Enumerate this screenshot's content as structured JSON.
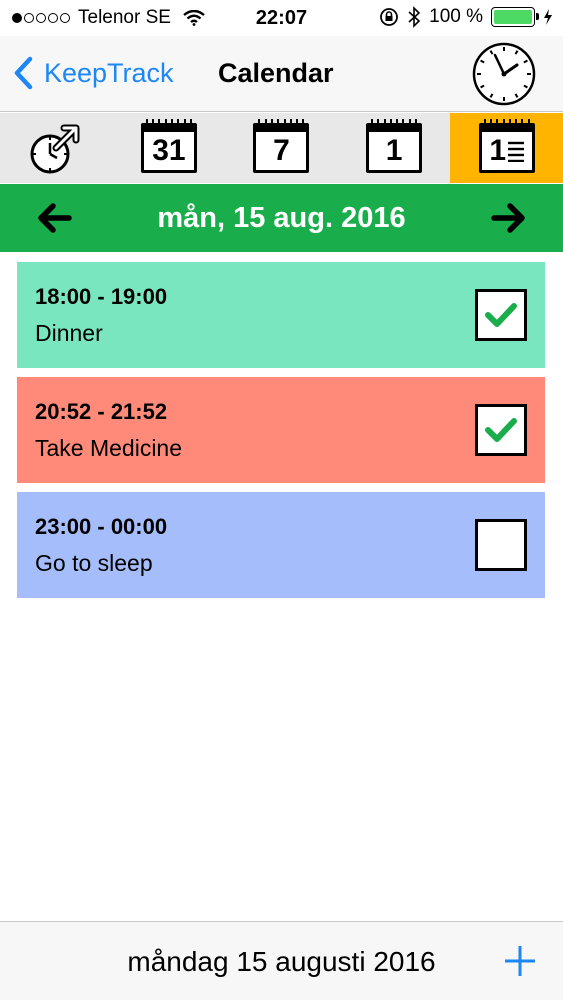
{
  "status_bar": {
    "carrier": "Telenor SE",
    "time": "22:07",
    "battery": "100 %",
    "battery_color": "#4cd964"
  },
  "nav": {
    "back_label": "KeepTrack",
    "title": "Calendar",
    "accent": "#1c87f5"
  },
  "view_toolbar": {
    "active_color": "#ffb400",
    "items": [
      {
        "icon": "clock-arrow-icon",
        "label": ""
      },
      {
        "icon": "calendar-month-icon",
        "label": "31"
      },
      {
        "icon": "calendar-week-icon",
        "label": "7"
      },
      {
        "icon": "calendar-day-icon",
        "label": "1"
      },
      {
        "icon": "calendar-agenda-icon",
        "label": "1",
        "active": true
      }
    ]
  },
  "date_header": {
    "title": "mån, 15 aug. 2016",
    "color": "#1aad4c"
  },
  "events": [
    {
      "time": "18:00 - 19:00",
      "title": "Dinner",
      "color": "#7ae6c0",
      "checked": true
    },
    {
      "time": "20:52 - 21:52",
      "title": "Take Medicine",
      "color": "#ff8a7a",
      "checked": true
    },
    {
      "time": "23:00 - 00:00",
      "title": "Go to sleep",
      "color": "#a6bdfc",
      "checked": false
    }
  ],
  "bottom_bar": {
    "date": "måndag 15 augusti 2016"
  }
}
